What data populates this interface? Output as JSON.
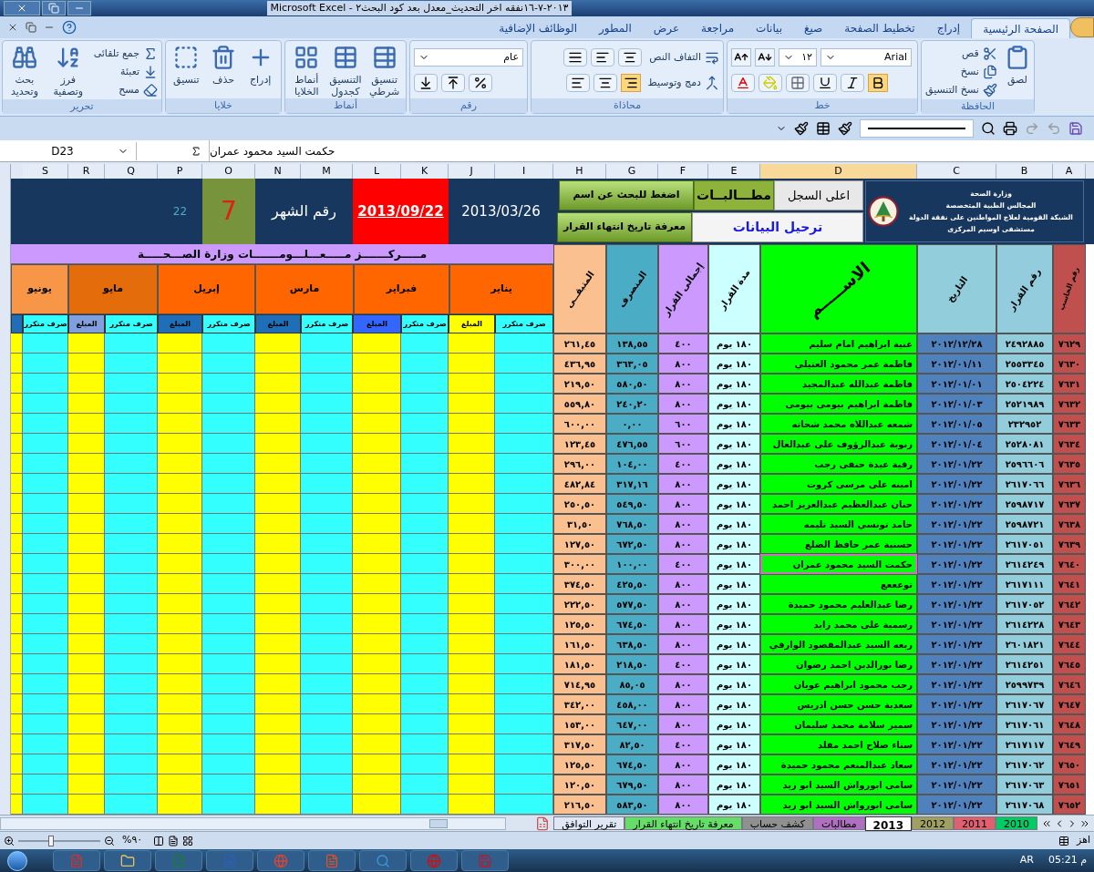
{
  "window": {
    "title": "٢٠١٣-٧-١٦نفقه اخر التحديث_معدل بعد كود البحث٢ - Microsoft Excel"
  },
  "ribbon": {
    "tabs": [
      {
        "label": "الصفحة الرئيسية",
        "selected": true
      },
      {
        "label": "إدراج",
        "selected": false
      },
      {
        "label": "تخطيط الصفحة",
        "selected": false
      },
      {
        "label": "صيغ",
        "selected": false
      },
      {
        "label": "بيانات",
        "selected": false
      },
      {
        "label": "مراجعة",
        "selected": false
      },
      {
        "label": "عرض",
        "selected": false
      },
      {
        "label": "المطور",
        "selected": false
      },
      {
        "label": "الوظائف الإضافية",
        "selected": false
      }
    ],
    "groups": [
      {
        "title": "الحافظة",
        "kind": "clipboard",
        "large": [
          "لصق"
        ],
        "small": [
          "قص",
          "نسخ",
          "نسخ التنسيق"
        ]
      },
      {
        "title": "خط",
        "kind": "font",
        "font": "Arial",
        "size": "١٢"
      },
      {
        "title": "محاذاة",
        "kind": "align",
        "small": [
          "التفاف النص",
          "دمج وتوسيط"
        ]
      },
      {
        "title": "رقم",
        "kind": "number",
        "format": "عام"
      },
      {
        "title": "أنماط",
        "kind": "large",
        "large": [
          "تنسيق شرطي",
          "التنسيق كجدول",
          "أنماط الخلايا"
        ]
      },
      {
        "title": "خلايا",
        "kind": "large",
        "large": [
          "إدراج",
          "حذف",
          "تنسيق"
        ]
      },
      {
        "title": "تحرير",
        "kind": "editing",
        "small": [
          "جمع تلقائى",
          "تعبئة",
          "مسح"
        ],
        "large": [
          "فرز وتصفية",
          "بحث وتحديد"
        ]
      }
    ]
  },
  "formula_bar": {
    "name_box": "D23",
    "content": "حكمت السيد محمود عمران"
  },
  "columns": [
    {
      "label": "A",
      "selected": false
    },
    {
      "label": "B",
      "selected": false
    },
    {
      "label": "C",
      "selected": false
    },
    {
      "label": "D",
      "selected": true
    },
    {
      "label": "E",
      "selected": false
    },
    {
      "label": "F",
      "selected": false
    },
    {
      "label": "G",
      "selected": false
    },
    {
      "label": "H",
      "selected": false
    },
    {
      "label": "I",
      "selected": false
    },
    {
      "label": "J",
      "selected": false
    },
    {
      "label": "K",
      "selected": false
    },
    {
      "label": "L",
      "selected": false
    },
    {
      "label": "M",
      "selected": false
    },
    {
      "label": "N",
      "selected": false
    },
    {
      "label": "O",
      "selected": false
    },
    {
      "label": "P",
      "selected": false
    },
    {
      "label": "Q",
      "selected": false
    },
    {
      "label": "R",
      "selected": false
    },
    {
      "label": "S",
      "selected": false
    }
  ],
  "banner": {
    "start_date": "2013/03/26",
    "end_date": "2013/09/22",
    "month_label": "رقم الشهر",
    "month_number": "7",
    "day_count": "22",
    "org_lines": [
      "وزارة الصحة",
      "المجالس الطبية المتخصصة",
      "الشبكة القومية لعلاج المواطنين على نفقة الدولة",
      "مستشفى اوسيم المركزى"
    ],
    "button_rows": [
      [
        {
          "label": "اعلى السجل",
          "kind": "plain"
        },
        {
          "label": "مطـــالبــات",
          "kind": "highlight"
        },
        {
          "label": "اضغط للبحث عن اسم",
          "kind": "action"
        }
      ],
      [
        {
          "label": "ترحيل البيانات",
          "kind": "link"
        },
        {
          "label": "معرفة تاريخ انتهاء القرار",
          "kind": "action"
        }
      ]
    ]
  },
  "center_title": "مـــــركـــــــز مـــــعـــلـــومـــــــات وزارة الصـــحـــــة",
  "months": [
    {
      "label": "يناير",
      "color": "#ff6600"
    },
    {
      "label": "فبراير",
      "color": "#ff6600"
    },
    {
      "label": "مارس",
      "color": "#ff6600"
    },
    {
      "label": "إبريل",
      "color": "#ff6600"
    },
    {
      "label": "مايو",
      "color": "#e46c0a"
    },
    {
      "label": "يونيو",
      "color": "#f79646"
    }
  ],
  "sub_headers": [
    {
      "label": "صرف متكرر",
      "kind": "repeat",
      "color": "#33ffff"
    },
    {
      "label": "المبلغ",
      "kind": "amount",
      "color": "#ffff00"
    },
    {
      "label": "صرف متكرر",
      "kind": "repeat",
      "color": "#33ffff"
    },
    {
      "label": "المبلغ",
      "kind": "amount",
      "color": "#3366ff"
    },
    {
      "label": "صرف متكرر",
      "kind": "repeat",
      "color": "#33ffff"
    },
    {
      "label": "المبلغ",
      "kind": "amount",
      "color": "#1f6fb8"
    },
    {
      "label": "صرف متكرر",
      "kind": "repeat",
      "color": "#33ffff"
    },
    {
      "label": "المبلغ",
      "kind": "amount",
      "color": "#1f6fb8"
    },
    {
      "label": "صرف متكرر",
      "kind": "repeat",
      "color": "#33ffff"
    },
    {
      "label": "المبلغ",
      "kind": "amount",
      "color": "#7f9fdf"
    },
    {
      "label": "صرف متكرر",
      "kind": "repeat",
      "color": "#33ffff"
    },
    {
      "kind": "amount",
      "color": "#1f6fb8"
    }
  ],
  "table_headers": [
    {
      "label": "رقم الحاسب",
      "color": "#c0504d"
    },
    {
      "label": "رقم القرار",
      "color": "#93cddd"
    },
    {
      "label": "التاريخ",
      "color": "#92cddc"
    },
    {
      "label": "الاســـــم",
      "color": "#00ff00"
    },
    {
      "label": "مدة القرار",
      "color": "#ccffff"
    },
    {
      "label": "إجمالى القرار",
      "color": "#cc99ff"
    },
    {
      "label": "المنصرف",
      "color": "#4bacc6"
    },
    {
      "label": "المتبقــى",
      "color": "#fac090"
    }
  ],
  "rows": [
    {
      "serial": "٧٦٢٩",
      "decision_no": "٢٤٩٢٨٨٥",
      "date": "٢٠١٢/١٢/٢٨",
      "name": "غنية ابراهيم امام سليم",
      "duration": "١٨٠ يوم",
      "total": "٤٠٠",
      "spent": "١٣٨,٥٥",
      "remaining": "٢٦١,٤٥",
      "selected": false
    },
    {
      "serial": "٧٦٣٠",
      "decision_no": "٢٥٥٣٣٤٥",
      "date": "٢٠١٢/٠١/١١",
      "name": "فاطمة عمر محمود العتيلي",
      "duration": "١٨٠ يوم",
      "total": "٨٠٠",
      "spent": "٣٦٣,٠٥",
      "remaining": "٤٣٦,٩٥",
      "selected": false
    },
    {
      "serial": "٧٦٣١",
      "decision_no": "٢٥٠٤٢٢٤",
      "date": "٢٠١٢/٠١/٠١",
      "name": "فاطمة عبدالله عبدالمجيد",
      "duration": "١٨٠ يوم",
      "total": "٨٠٠",
      "spent": "٥٨٠,٥٠",
      "remaining": "٢١٩,٥٠",
      "selected": false
    },
    {
      "serial": "٧٦٣٢",
      "decision_no": "٢٥٢١٩٨٩",
      "date": "٢٠١٢/٠١/٠٣",
      "name": "فاطمة ابراهيم بيومى بيومى",
      "duration": "١٨٠ يوم",
      "total": "٨٠٠",
      "spent": "٢٤٠,٢٠",
      "remaining": "٥٥٩,٨٠",
      "selected": false
    },
    {
      "serial": "٧٦٣٣",
      "decision_no": "٢٣٢٩٥٢",
      "date": "٢٠١٢/٠١/٠٥",
      "name": "شمعه عبداللاه محمد شحاته",
      "duration": "١٨٠ يوم",
      "total": "٦٠٠",
      "spent": "٠,٠٠",
      "remaining": "٦٠٠,٠٠",
      "selected": false
    },
    {
      "serial": "٧٦٣٤",
      "decision_no": "٢٥٢٨٠٨١",
      "date": "٢٠١٢/٠١/٠٤",
      "name": "زنوبة عبدالرؤوف على عبدالعال",
      "duration": "١٨٠ يوم",
      "total": "٦٠٠",
      "spent": "٤٧٦,٥٥",
      "remaining": "١٢٣,٤٥",
      "selected": false
    },
    {
      "serial": "٧٦٣٥",
      "decision_no": "٢٥٩٦٦٠٦",
      "date": "٢٠١٢/٠١/٢٢",
      "name": "رقية عيدة حنفى رجب",
      "duration": "١٨٠ يوم",
      "total": "٤٠٠",
      "spent": "١٠٤,٠٠",
      "remaining": "٢٩٦,٠٠",
      "selected": false
    },
    {
      "serial": "٧٦٣٦",
      "decision_no": "٢٦١٧٠٦٦",
      "date": "٢٠١٢/٠١/٢٢",
      "name": "امينه على مرسى كروت",
      "duration": "١٨٠ يوم",
      "total": "٨٠٠",
      "spent": "٣١٧,١٦",
      "remaining": "٤٨٢,٨٤",
      "selected": false
    },
    {
      "serial": "٧٦٣٧",
      "decision_no": "٢٥٩٨٧١٧",
      "date": "٢٠١٢/٠١/٢٢",
      "name": "حنان عبدالعظيم عبدالعزيز احمد",
      "duration": "١٨٠ يوم",
      "total": "٨٠٠",
      "spent": "٥٤٩,٥٠",
      "remaining": "٢٥٠,٥٠",
      "selected": false
    },
    {
      "serial": "٧٦٣٨",
      "decision_no": "٢٥٩٨٧٢١",
      "date": "٢٠١٢/٠١/٢٢",
      "name": "حامد تونسي السيد تليمه",
      "duration": "١٨٠ يوم",
      "total": "٨٠٠",
      "spent": "٧٦٨,٥٠",
      "remaining": "٣١,٥٠",
      "selected": false
    },
    {
      "serial": "٧٦٣٩",
      "decision_no": "٢٦١٧٠٥١",
      "date": "٢٠١٢/٠١/٢٢",
      "name": "حسنية عمر حافظ الضلع",
      "duration": "١٨٠ يوم",
      "total": "٨٠٠",
      "spent": "٦٧٢,٥٠",
      "remaining": "١٢٧,٥٠",
      "selected": false
    },
    {
      "serial": "٧٦٤٠",
      "decision_no": "٢٦١٤٢٤٩",
      "date": "٢٠١٢/٠١/٢٢",
      "name": "حكمت السيد محمود عمران",
      "duration": "١٨٠ يوم",
      "total": "٤٠٠",
      "spent": "١٠٠,٠٠",
      "remaining": "٣٠٠,٠٠",
      "selected": true
    },
    {
      "serial": "٧٦٤١",
      "decision_no": "٢٦١٧١١١",
      "date": "٢٠١٢/٠١/٢٢",
      "name": "توعععع",
      "duration": "١٨٠ يوم",
      "total": "٨٠٠",
      "spent": "٤٢٥,٥٠",
      "remaining": "٣٧٤,٥٠",
      "selected": false
    },
    {
      "serial": "٧٦٤٢",
      "decision_no": "٢٦١٧٠٥٢",
      "date": "٢٠١٢/٠١/٢٢",
      "name": "رضا عبدالعليم محمود حميدة",
      "duration": "١٨٠ يوم",
      "total": "٨٠٠",
      "spent": "٥٧٧,٥٠",
      "remaining": "٢٢٢,٥٠",
      "selected": false
    },
    {
      "serial": "٧٦٤٣",
      "decision_no": "٢٦١٤٢٢٨",
      "date": "٢٠١٢/٠١/٢٢",
      "name": "رسمية على محمد زايد",
      "duration": "١٨٠ يوم",
      "total": "٨٠٠",
      "spent": "٦٧٤,٥٠",
      "remaining": "١٢٥,٥٠",
      "selected": false
    },
    {
      "serial": "٧٦٤٤",
      "decision_no": "٢٦٠١٨٢١",
      "date": "٢٠١٢/٠١/٢٢",
      "name": "ربعه السيد عبدالمقصود الوارقي",
      "duration": "١٨٠ يوم",
      "total": "٨٠٠",
      "spent": "٦٣٨,٥٠",
      "remaining": "١٦١,٥٠",
      "selected": false
    },
    {
      "serial": "٧٦٤٥",
      "decision_no": "٢٦١٤٢٥١",
      "date": "٢٠١٢/٠١/٢٢",
      "name": "رضا نورالدين احمد رضوان",
      "duration": "١٨٠ يوم",
      "total": "٤٠٠",
      "spent": "٢١٨,٥٠",
      "remaining": "١٨١,٥٠",
      "selected": false
    },
    {
      "serial": "٧٦٤٦",
      "decision_no": "٢٥٩٩٧٣٩",
      "date": "٢٠١٢/٠١/٢٢",
      "name": "رجب محمود ابراهيم عويان",
      "duration": "١٨٠ يوم",
      "total": "٨٠٠",
      "spent": "٨٥,٠٥",
      "remaining": "٧١٤,٩٥",
      "selected": false
    },
    {
      "serial": "٧٦٤٧",
      "decision_no": "٢٦١٧٠٦٧",
      "date": "٢٠١٢/٠١/٢٢",
      "name": "سعدية حسن حسن ادريس",
      "duration": "١٨٠ يوم",
      "total": "٨٠٠",
      "spent": "٤٥٨,٠٠",
      "remaining": "٣٤٢,٠٠",
      "selected": false
    },
    {
      "serial": "٧٦٤٨",
      "decision_no": "٢٦١٧٠٦١",
      "date": "٢٠١٢/٠١/٢٢",
      "name": "سمير سلامة محمد سليمان",
      "duration": "١٨٠ يوم",
      "total": "٨٠٠",
      "spent": "٦٤٧,٠٠",
      "remaining": "١٥٣,٠٠",
      "selected": false
    },
    {
      "serial": "٧٦٤٩",
      "decision_no": "٢٦١٧١١٧",
      "date": "٢٠١٢/٠١/٢٢",
      "name": "سناء صلاح احمد مقلد",
      "duration": "١٨٠ يوم",
      "total": "٤٠٠",
      "spent": "٨٢,٥٠",
      "remaining": "٣١٧,٥٠",
      "selected": false
    },
    {
      "serial": "٧٦٥٠",
      "decision_no": "٢٦١٧٠٦٢",
      "date": "٢٠١٢/٠١/٢٢",
      "name": "سعاد عبدالمنعم محمود حميدة",
      "duration": "١٨٠ يوم",
      "total": "٨٠٠",
      "spent": "٦٧٤,٥٠",
      "remaining": "١٢٥,٥٠",
      "selected": false
    },
    {
      "serial": "٧٦٥١",
      "decision_no": "٢٦١٧٠٦٣",
      "date": "٢٠١٢/٠١/٢٢",
      "name": "سامى ابورواش السيد ابو زيد",
      "duration": "١٨٠ يوم",
      "total": "٨٠٠",
      "spent": "٦٧٩,٥٠",
      "remaining": "١٢٠,٥٠",
      "selected": false
    },
    {
      "serial": "٧٦٥٢",
      "decision_no": "٢٦١٧٠٦٨",
      "date": "٢٠١٢/٠١/٢٢",
      "name": "سامى ابورواش السيد ابو زيد",
      "duration": "١٨٠ يوم",
      "total": "٨٠٠",
      "spent": "٥٨٣,٥٠",
      "remaining": "٢١٦,٥٠",
      "selected": false
    }
  ],
  "sheet_tabs": [
    {
      "label": "2010",
      "selected": false,
      "color": "#00cc66"
    },
    {
      "label": "2011",
      "selected": false,
      "color": "#e06070"
    },
    {
      "label": "2012",
      "selected": false,
      "color": "#a0a060"
    },
    {
      "label": "2013",
      "selected": true,
      "color": "#ffffff"
    },
    {
      "label": "مطالبات",
      "selected": false,
      "color": "#b070c0"
    },
    {
      "label": "كشف حساب",
      "selected": false,
      "color": "#909090"
    },
    {
      "label": "معرفة تاريخ انتهاء القرار",
      "selected": false,
      "color": "#66dd66"
    },
    {
      "label": "تقرير التوافق",
      "selected": false,
      "color": "#dfe8f5"
    }
  ],
  "status_bar": {
    "status": "اهز",
    "zoom": "%٩٠",
    "zoom_level": {
      "level": 0.4
    }
  },
  "taskbar": {
    "language": "AR",
    "clock": "م 05:21"
  }
}
